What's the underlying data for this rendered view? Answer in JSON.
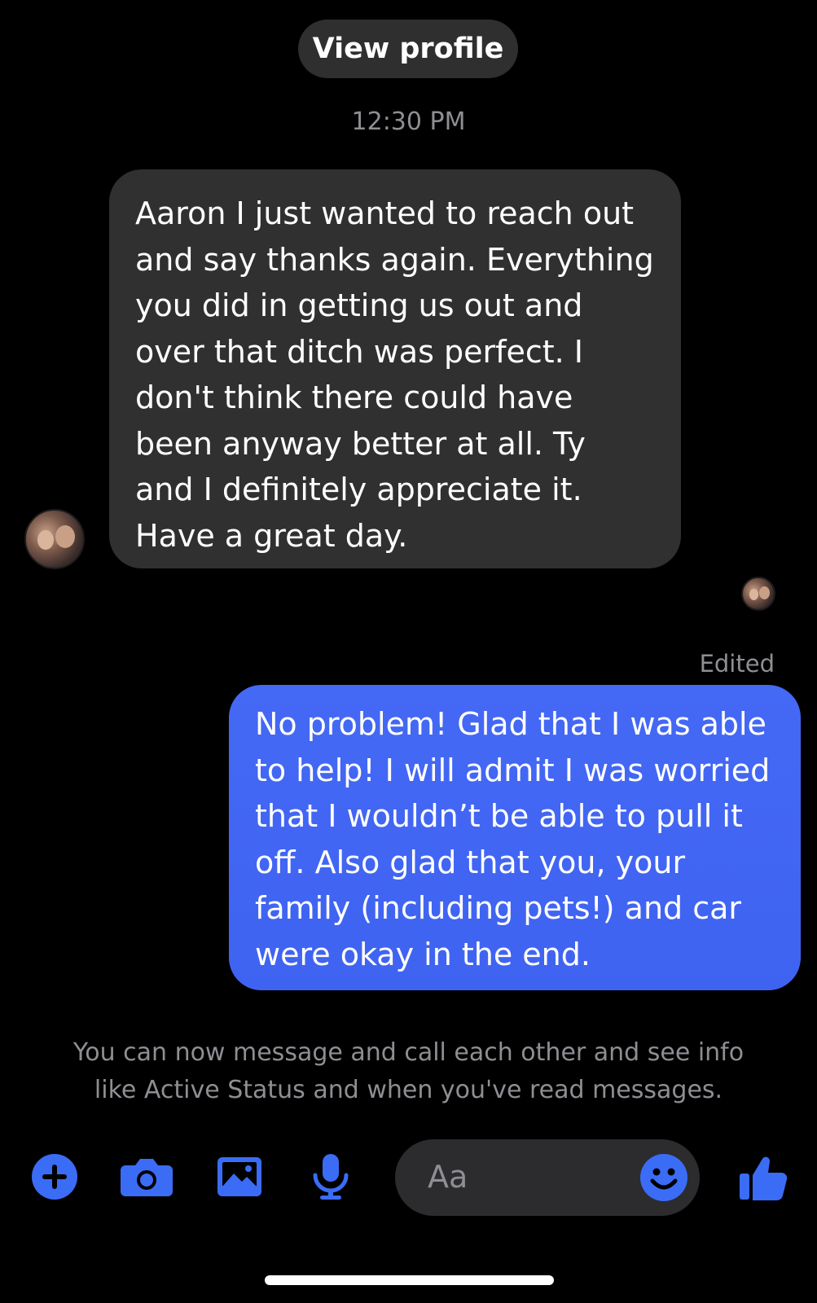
{
  "header": {
    "view_profile_label": "View profile",
    "timestamp": "12:30 PM"
  },
  "messages": {
    "incoming": {
      "lines": [
        "Aaron I just wanted to reach out",
        "and say thanks again. Everything",
        "you did in getting us out and",
        "over that ditch was perfect. I",
        "don't think there could have",
        "been anyway better at all. Ty",
        "and I definitely appreciate it.",
        "Have a great day."
      ]
    },
    "outgoing": {
      "edited_label": "Edited",
      "lines": [
        "No problem! Glad that I was able",
        "to help! I will admit I was worried",
        "that I wouldn’t be able to pull it",
        "off. Also glad that you, your",
        "family (including pets!) and car",
        "were okay in the end."
      ]
    }
  },
  "system_notice": {
    "line1": "You can now message and call each other and see info",
    "line2": "like Active Status and when you've read messages."
  },
  "composer": {
    "placeholder": "Aa",
    "icons": [
      "plus-icon",
      "camera-icon",
      "image-icon",
      "microphone-icon",
      "emoji-icon",
      "thumbs-up-icon"
    ]
  },
  "colors": {
    "accent": "#3b6cf6",
    "incoming_bubble": "#303030",
    "outgoing_bubble": "#4469f5",
    "muted_text": "#8e8e93"
  }
}
